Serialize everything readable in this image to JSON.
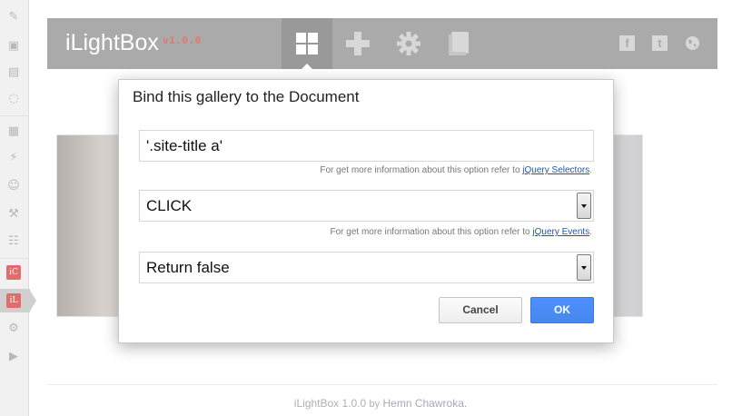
{
  "header": {
    "app_name": "iLightBox",
    "version": "v1.0.0",
    "nav": [
      {
        "icon": "grid-icon",
        "active": true
      },
      {
        "icon": "plus-icon",
        "active": false
      },
      {
        "icon": "gear-icon",
        "active": false
      },
      {
        "icon": "book-icon",
        "active": false
      }
    ],
    "social": [
      {
        "icon": "facebook-icon",
        "glyph": "f"
      },
      {
        "icon": "twitter-icon",
        "glyph": "t"
      },
      {
        "icon": "globe-icon",
        "glyph": ""
      }
    ]
  },
  "sidebar": {
    "items": [
      {
        "icon": "pin-icon"
      },
      {
        "icon": "media-icon"
      },
      {
        "icon": "pages-icon"
      },
      {
        "icon": "comments-icon"
      },
      {
        "icon": "appearance-icon"
      },
      {
        "icon": "plugins-icon"
      },
      {
        "icon": "users-icon"
      },
      {
        "icon": "tools-icon"
      },
      {
        "icon": "settings-icon"
      },
      {
        "icon": "ic-app-icon",
        "glyph": "iC"
      },
      {
        "icon": "il-app-icon",
        "glyph": "iL",
        "active": true
      },
      {
        "icon": "gear-icon"
      },
      {
        "icon": "collapse-icon"
      }
    ]
  },
  "modal": {
    "title": "Bind this gallery to the Document",
    "selector_value": "'.site-title a'",
    "selector_help": "For get more information about this option refer to",
    "selector_link": "jQuery Selectors",
    "event_value": "CLICK",
    "event_help": "For get more information about this option refer to",
    "event_link": "jQuery Events",
    "return_value": "Return false",
    "cancel_label": "Cancel",
    "ok_label": "OK"
  },
  "footer": {
    "app": "iLightBox 1.0.0",
    "by": "by",
    "author": "Hemn Chawroka."
  },
  "colors": {
    "header_bg": "#aaaaaa",
    "version": "#e07a6a",
    "ok_button": "#4d90fe",
    "sidebar_app_icon": "#e26c6c"
  }
}
